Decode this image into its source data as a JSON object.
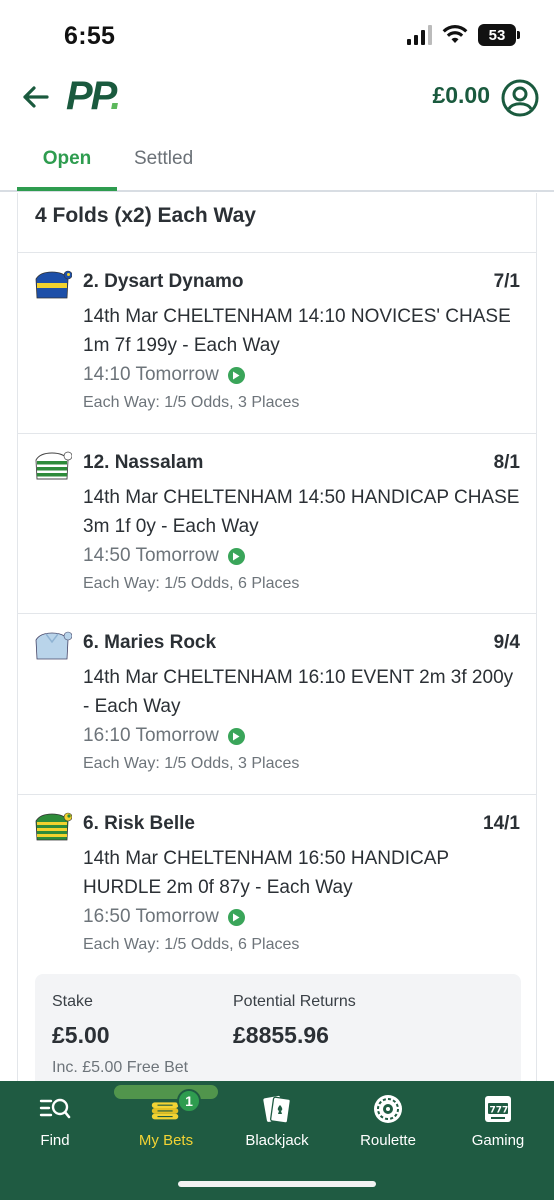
{
  "status_bar": {
    "time": "6:55",
    "battery": "53"
  },
  "header": {
    "logo": "PP",
    "balance": "£0.00"
  },
  "tabs": [
    {
      "label": "Open"
    },
    {
      "label": "Settled"
    }
  ],
  "bet": {
    "title": "4 Folds (x2) Each Way",
    "selections": [
      {
        "name": "2. Dysart Dynamo",
        "odds": "7/1",
        "event": "14th Mar CHELTENHAM 14:10 NOVICES' CHASE 1m 7f 199y - Each Way",
        "time": "14:10 Tomorrow",
        "each_way": "Each Way: 1/5 Odds, 3 Places"
      },
      {
        "name": "12. Nassalam",
        "odds": "8/1",
        "event": "14th Mar CHELTENHAM 14:50 HANDICAP CHASE 3m 1f 0y - Each Way",
        "time": "14:50 Tomorrow",
        "each_way": "Each Way: 1/5 Odds, 6 Places"
      },
      {
        "name": "6. Maries Rock",
        "odds": "9/4",
        "event": "14th Mar CHELTENHAM 16:10 EVENT 2m 3f 200y - Each Way",
        "time": "16:10 Tomorrow",
        "each_way": "Each Way: 1/5 Odds, 3 Places"
      },
      {
        "name": "6. Risk Belle",
        "odds": "14/1",
        "event": "14th Mar CHELTENHAM 16:50 HANDICAP HURDLE 2m 0f 87y - Each Way",
        "time": "16:50 Tomorrow",
        "each_way": "Each Way: 1/5 Odds, 6 Places"
      }
    ],
    "stake_label": "Stake",
    "stake": "£5.00",
    "stake_note": "Inc. £5.00 Free Bet",
    "returns_label": "Potential Returns",
    "returns": "£8855.96"
  },
  "bottom_nav": {
    "items": [
      {
        "label": "Find"
      },
      {
        "label": "My Bets"
      },
      {
        "label": "Blackjack"
      },
      {
        "label": "Roulette"
      },
      {
        "label": "Gaming"
      }
    ],
    "badge": "1"
  },
  "colors": {
    "brand_green": "#1a5a3e",
    "accent_green": "#2e9c4f",
    "nav_bg": "#1f5b42",
    "nav_active": "#f2d334"
  },
  "icons": [
    "back-arrow-icon",
    "account-icon",
    "play-icon",
    "find-icon",
    "my-bets-icon",
    "blackjack-icon",
    "roulette-icon",
    "gaming-icon"
  ]
}
